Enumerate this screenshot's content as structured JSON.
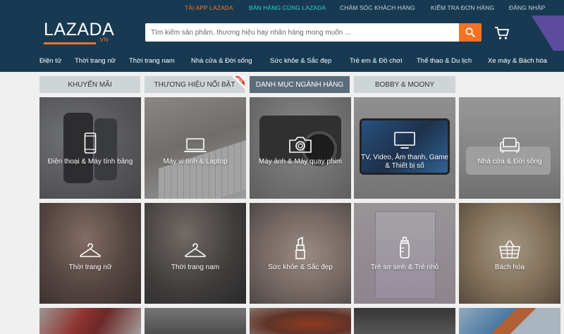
{
  "topbar": {
    "links": [
      {
        "label": "TẢI APP LAZADA",
        "color": "orange"
      },
      {
        "label": "BÁN HÀNG CÙNG LAZADA",
        "color": "cyan"
      },
      {
        "label": "CHĂM SÓC KHÁCH HÀNG",
        "color": "default"
      },
      {
        "label": "KIỂM TRA ĐƠN HÀNG",
        "color": "default"
      },
      {
        "label": "ĐĂNG NHẬP",
        "color": "default"
      }
    ]
  },
  "header": {
    "logo": "LAZADA",
    "logo_suffix": ".VN",
    "search_placeholder": "Tìm kiếm sản phẩm, thương hiệu hay nhãn hàng mong muốn ..."
  },
  "categories": [
    "Điện tử",
    "Thời trang nữ",
    "Thời trang nam",
    "Nhà cửa & Đời sống",
    "Sức khỏe & Sắc đẹp",
    "Trẻ em & Đồ chơi",
    "Thể thao & Du lịch",
    "Xe máy & Bách hóa"
  ],
  "tabs": [
    {
      "label": "KHUYẾN MÃI",
      "active": false
    },
    {
      "label": "THƯƠNG HIỆU NỔI BẬT",
      "active": false,
      "badge": "HOT"
    },
    {
      "label": "DANH MỤC NGÀNH HÀNG",
      "active": true
    },
    {
      "label": "BOBBY & MOONY",
      "active": false
    }
  ],
  "tiles": [
    {
      "label": "Điện thoại & Máy tính bảng",
      "icon": "smartphone-icon"
    },
    {
      "label": "Máy vi tính & Laptop",
      "icon": "laptop-icon"
    },
    {
      "label": "Máy ảnh & Máy quay phim",
      "icon": "camera-icon"
    },
    {
      "label": "TV, Video, Âm thanh, Game & Thiết bị số",
      "icon": "tv-icon"
    },
    {
      "label": "Nhà cửa & Đời sống",
      "icon": "sofa-icon"
    },
    {
      "label": "Thời trang nữ",
      "icon": "hanger-icon"
    },
    {
      "label": "Thời trang nam",
      "icon": "hanger-icon"
    },
    {
      "label": "Sức khỏe & Sắc đẹp",
      "icon": "lipstick-icon"
    },
    {
      "label": "Trẻ sơ sinh & Trẻ nhỏ",
      "icon": "baby-bottle-icon"
    },
    {
      "label": "Bách hóa",
      "icon": "basket-icon"
    }
  ],
  "colors": {
    "header_bg": "#173a52",
    "accent": "#f57224",
    "cyan": "#2fd3c9",
    "active_tab": "#5b6d78"
  }
}
